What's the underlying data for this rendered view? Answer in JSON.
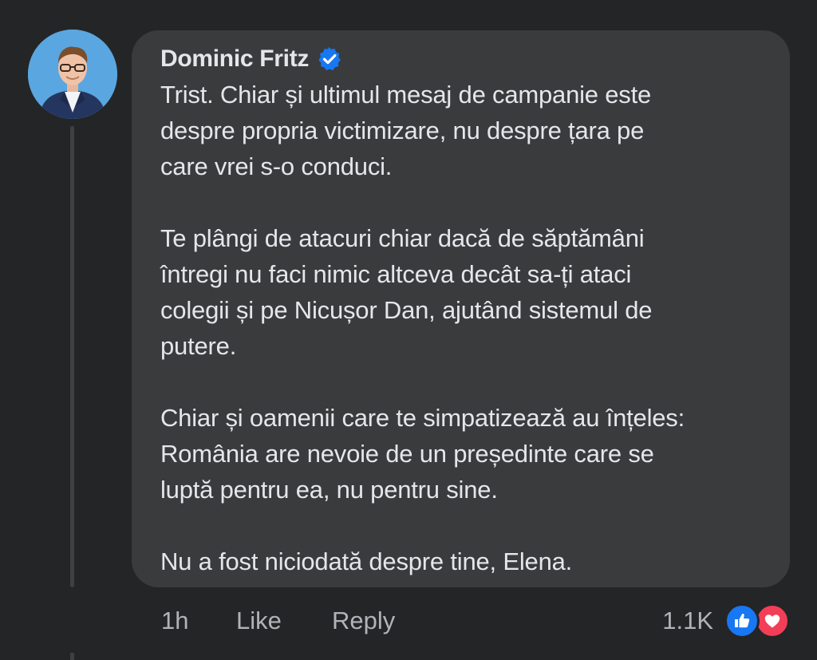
{
  "comment": {
    "author": "Dominic Fritz",
    "paragraphs": [
      [
        "Trist. Chiar și ultimul mesaj de campanie este",
        "despre propria victimizare, nu despre țara pe",
        "care vrei s-o conduci."
      ],
      [
        "Te plângi de atacuri chiar dacă de săptămâni",
        "întregi nu faci nimic altceva decât sa-ți ataci",
        "colegii și pe Nicușor Dan, ajutând sistemul de",
        "putere."
      ],
      [
        "Chiar și oamenii care te simpatizează au înțeles:",
        "România are nevoie de un președinte care se",
        "luptă pentru ea, nu pentru sine."
      ],
      [
        "Nu a fost niciodată despre tine, Elena."
      ]
    ],
    "timestamp": "1h",
    "like_label": "Like",
    "reply_label": "Reply",
    "reaction_count": "1.1K",
    "reactions": [
      "like-icon",
      "love-icon"
    ]
  },
  "colors": {
    "background": "#242526",
    "bubble": "#3a3b3c",
    "text": "#e4e6eb",
    "secondary_text": "#b0b3b8",
    "verified": "#1877f2",
    "like": "#1877f2",
    "love": "#f33e58"
  }
}
